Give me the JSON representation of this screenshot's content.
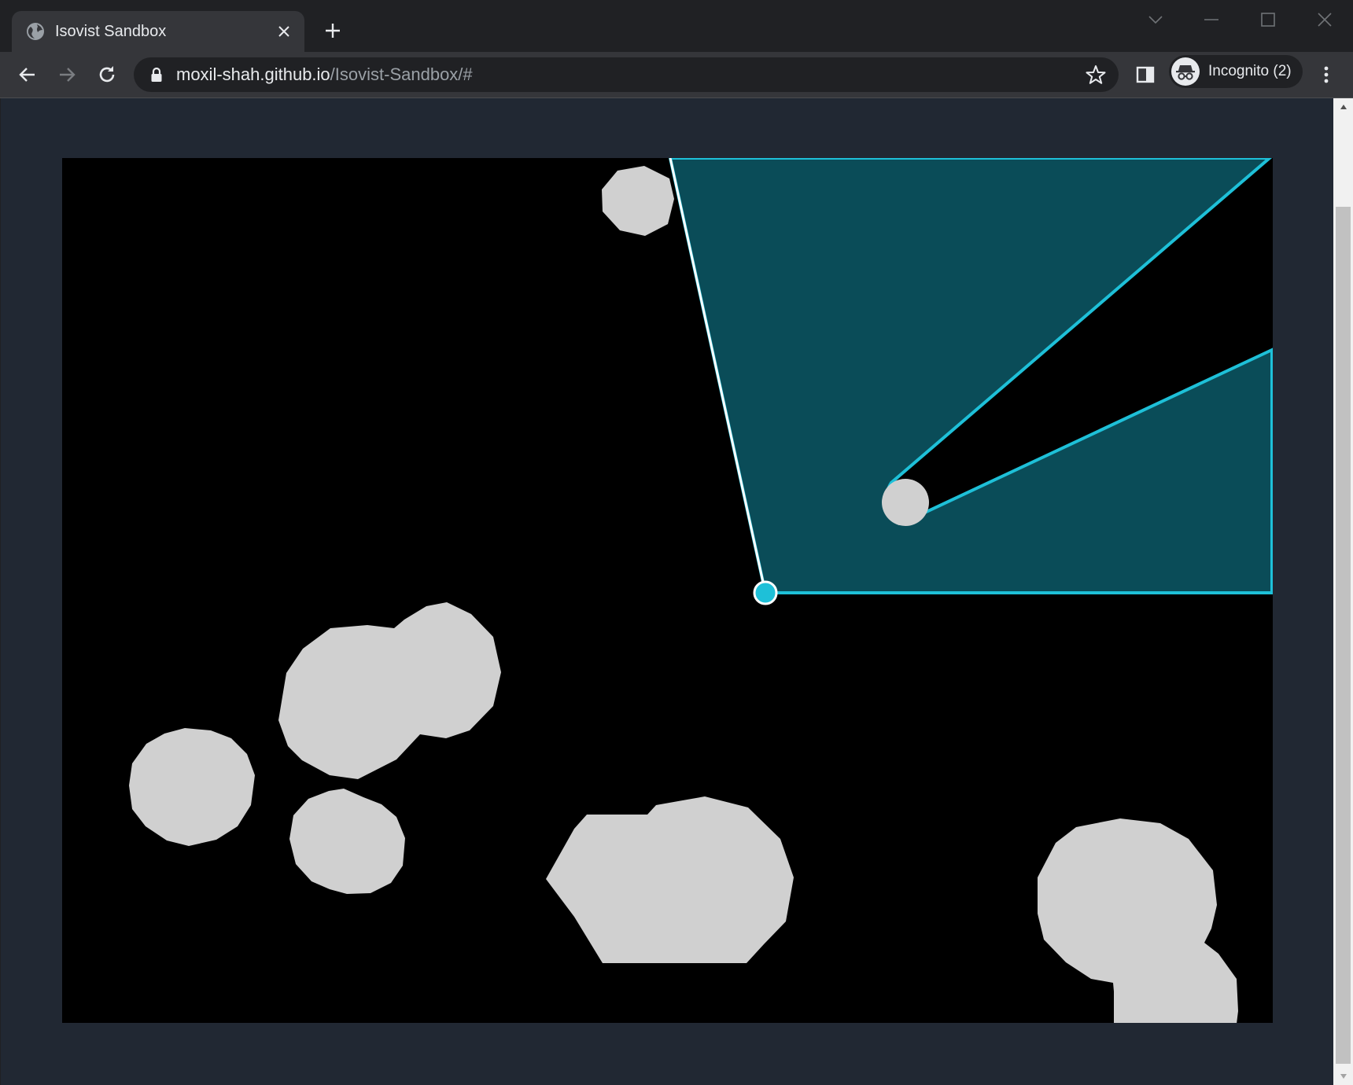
{
  "tab": {
    "title": "Isovist Sandbox"
  },
  "address_bar": {
    "url_host": "moxil-shah.github.io",
    "url_path": "/Isovist-Sandbox/#"
  },
  "profile": {
    "label": "Incognito (2)"
  },
  "canvas": {
    "background": "#000000",
    "obstacle_color": "#d0d0d0",
    "isovist_fill": "#0a4c58",
    "isovist_stroke": "#1ec0d8",
    "viewer_color": "#1ec0d8"
  }
}
